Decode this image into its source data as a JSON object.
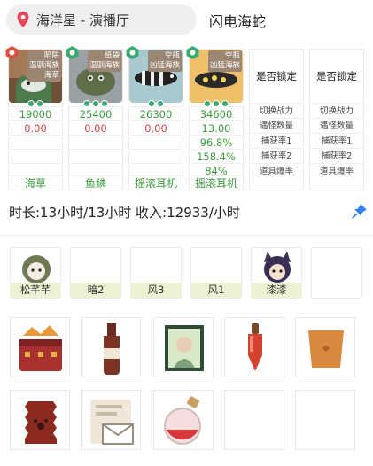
{
  "header": {
    "location": "海洋星 - 演播厅",
    "title": "闪电海蛇"
  },
  "cards": [
    {
      "tag": "陷阱\n温驯海族\n海草",
      "power": "19000",
      "stat2": "0.00",
      "name": "海草"
    },
    {
      "tag": "纸袋\n温驯海族",
      "power": "25400",
      "stat2": "0.00",
      "name": "鱼鳞"
    },
    {
      "tag": "空瓶\n凶猛海族",
      "power": "26300",
      "stat2": "0.00",
      "name": "摇滚耳机"
    },
    {
      "tag": "空瓶\n凶猛海族",
      "power": "34600",
      "stat2": "13.00",
      "stat3": "96.8%",
      "stat4": "158.4%",
      "stat5": "84%",
      "name": "摇滚耳机"
    }
  ],
  "lock_columns": [
    {
      "title": "是否锁定",
      "rows": [
        "切换战力",
        "遇怪数量",
        "捕获率1",
        "捕获率2",
        "道具爆率"
      ]
    },
    {
      "title": "是否锁定",
      "rows": [
        "切换战力",
        "遇怪数量",
        "捕获率1",
        "捕获率2",
        "道具爆率"
      ]
    }
  ],
  "summary": "时长:13小时/13小时 收入:12933/小时",
  "team": [
    "松芊芊",
    "暗2",
    "风3",
    "风1",
    "漆漆"
  ],
  "colors": {
    "green": "#3c9b3c",
    "red": "#d94040",
    "tag_bg": "#9a8673",
    "slot_label_bg": "#eef2d4"
  }
}
